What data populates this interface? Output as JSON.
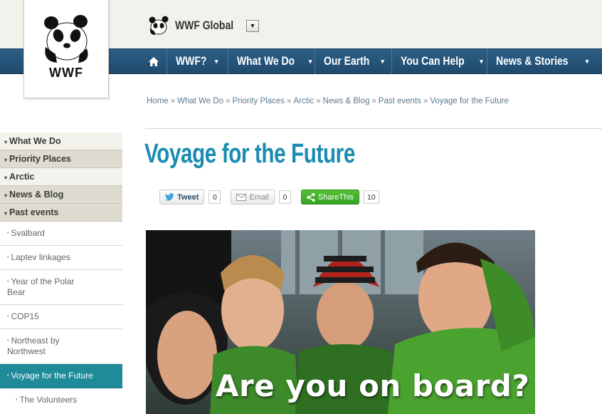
{
  "logo": {
    "text": "WWF",
    "icon": "panda-icon"
  },
  "header": {
    "global_label": "WWF Global",
    "global_dropdown_icon": "dropdown-arrow-icon",
    "nav": [
      {
        "label": "WWF?"
      },
      {
        "label": "What We Do"
      },
      {
        "label": "Our Earth"
      },
      {
        "label": "You Can Help"
      },
      {
        "label": "News & Stories"
      }
    ],
    "home_icon": "home-icon",
    "caret": "▾"
  },
  "breadcrumb": [
    "Home",
    "What We Do",
    "Priority Places",
    "Arctic",
    "News & Blog",
    "Past events",
    "Voyage for the Future"
  ],
  "breadcrumb_sep": "»",
  "sidebar": {
    "main": [
      {
        "label": "What We Do"
      },
      {
        "label": "Priority Places"
      },
      {
        "label": "Arctic"
      },
      {
        "label": "News & Blog"
      },
      {
        "label": "Past events"
      }
    ],
    "sub": [
      {
        "label": "Svalbard"
      },
      {
        "label": "Laptev linkages"
      },
      {
        "label": "Year of the Polar Bear"
      },
      {
        "label": "COP15"
      },
      {
        "label": "Northeast by Northwest"
      },
      {
        "label": "Voyage for the Future"
      },
      {
        "label": "The Volunteers"
      }
    ],
    "bullet": "▾",
    "sub_bullet": "•"
  },
  "main": {
    "title": "Voyage for the Future",
    "share": {
      "tweet_label": "Tweet",
      "tweet_count": "0",
      "email_label": "Email",
      "email_count": "0",
      "sharethis_label": "ShareThis",
      "sharethis_count": "10"
    },
    "hero_caption": "Are you on board?"
  },
  "colors": {
    "nav_bg": "#2d5f86",
    "title": "#1a8bb1",
    "active_sidebar": "#1e8a9a",
    "share_green": "#3bab27"
  }
}
